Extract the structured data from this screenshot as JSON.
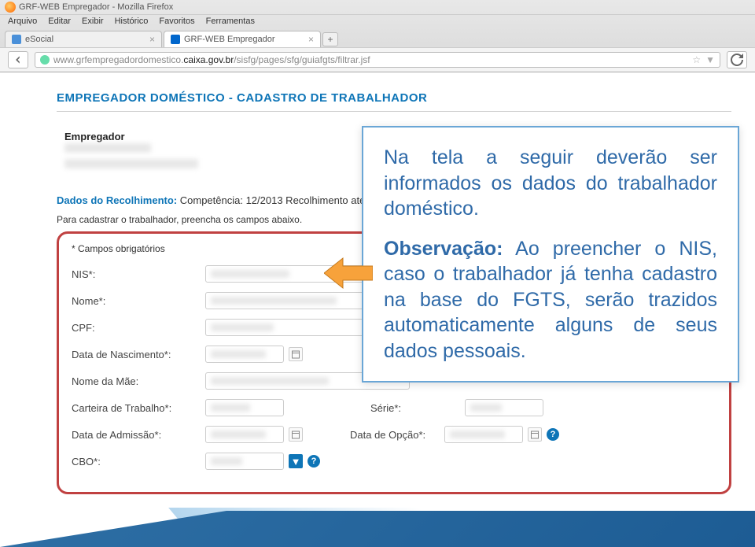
{
  "window": {
    "title": "GRF-WEB Empregador - Mozilla Firefox"
  },
  "menu": [
    "Arquivo",
    "Editar",
    "Exibir",
    "Histórico",
    "Favoritos",
    "Ferramentas"
  ],
  "tabs": [
    {
      "label": "eSocial",
      "close": "×"
    },
    {
      "label": "GRF-WEB Empregador",
      "close": "×"
    }
  ],
  "new_tab": "+",
  "url": {
    "gray_before": "www.grfempregadordomestico.",
    "dark": "caixa.gov.br",
    "gray_after": "/sisfg/pages/sfg/guiafgts/filtrar.jsf"
  },
  "page": {
    "title": "EMPREGADOR DOMÉSTICO - CADASTRO DE TRABALHADOR"
  },
  "empregador": {
    "label": "Empregador"
  },
  "dados": {
    "blue": "Dados do Recolhimento:",
    "rest": "Competência: 12/2013 Recolhimento até"
  },
  "instr": "Para cadastrar o trabalhador, preencha os campos abaixo.",
  "obrig": "* Campos obrigatórios",
  "labels": {
    "nis": "NIS*:",
    "nome": "Nome*:",
    "cpf": "CPF:",
    "nasc": "Data de Nascimento*:",
    "mae": "Nome da Mãe:",
    "ct": "Carteira de Trabalho*:",
    "serie": "Série*:",
    "adm": "Data de Admissão*:",
    "opcao": "Data de Opção*:",
    "cbo": "CBO*:"
  },
  "callout": {
    "p1": "Na tela a seguir deverão ser informados os dados do trabalhador doméstico.",
    "obs_label": "Observação:",
    "p2": "Ao preencher o NIS, caso o trabalhador já tenha cadastro na base do FGTS, serão trazidos automaticamente alguns de seus dados pessoais."
  },
  "help": "?",
  "star": "☆",
  "dd": "▼"
}
